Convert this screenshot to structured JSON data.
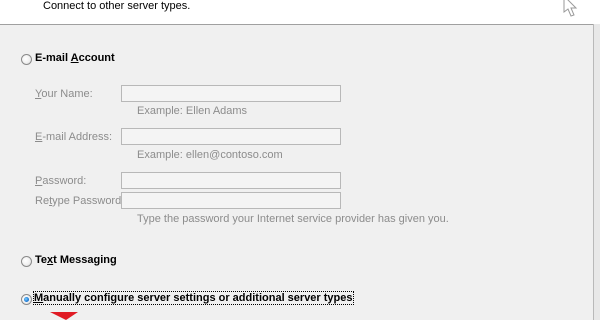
{
  "header": {
    "description": "Connect to other server types."
  },
  "options": {
    "email_account": {
      "label_pre": "E-mail ",
      "label_mnemonic": "A",
      "label_post": "ccount",
      "selected": false
    },
    "text_messaging": {
      "label_pre": "Te",
      "label_mnemonic": "x",
      "label_post": "t Messaging",
      "selected": false
    },
    "manual_config": {
      "label_mnemonic": "M",
      "label_post": "anually configure server settings or additional server types",
      "selected": true
    }
  },
  "form": {
    "your_name": {
      "label_mnemonic": "Y",
      "label_post": "our Name:",
      "value": "",
      "hint": "Example: Ellen Adams"
    },
    "email_address": {
      "label_mnemonic": "E",
      "label_post": "-mail Address:",
      "value": "",
      "hint": "Example: ellen@contoso.com"
    },
    "password": {
      "label_mnemonic": "P",
      "label_post": "assword:",
      "value": ""
    },
    "retype_password": {
      "label_pre": "Re",
      "label_mnemonic": "t",
      "label_post": "ype Password:",
      "value": "",
      "hint": "Type the password your Internet service provider has given you."
    }
  },
  "colors": {
    "header_bg": "#ffffff",
    "dialog_bg": "#f0f0f0",
    "disabled_text": "#8c8c8c",
    "radio_selected": "#1c7ad6",
    "marker_red": "#e01b24"
  }
}
